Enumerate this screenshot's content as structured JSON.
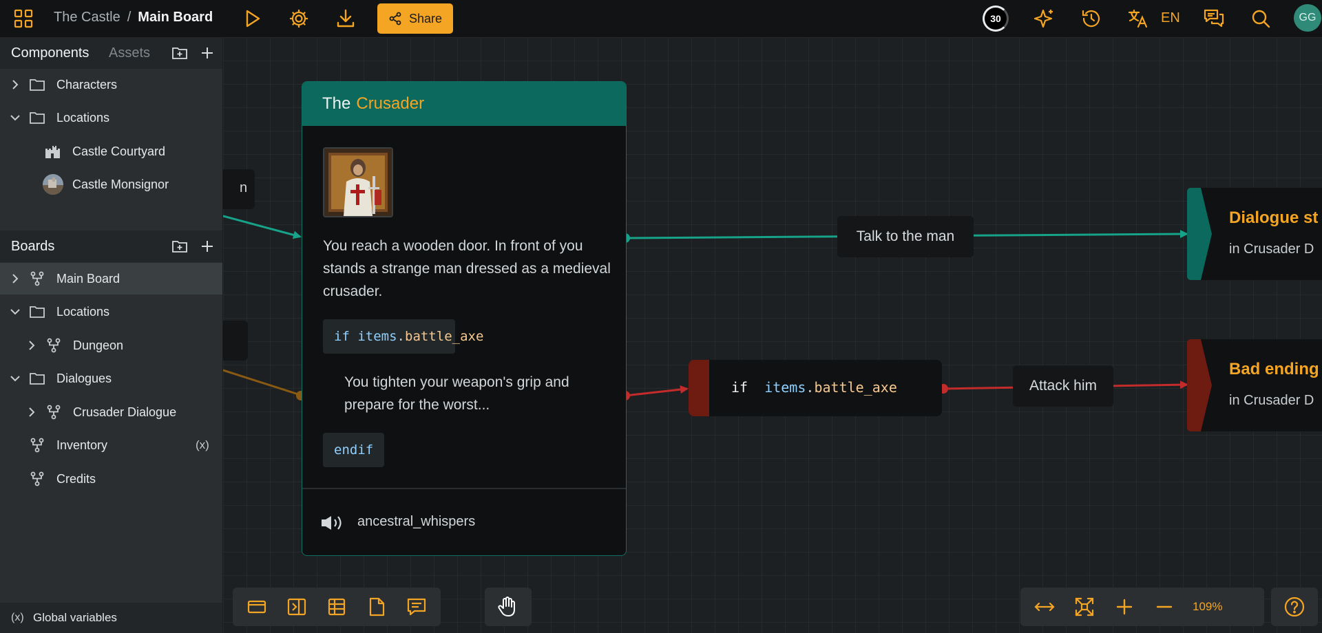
{
  "colors": {
    "accent": "#f5a524",
    "teal": "#0b6a5d",
    "danger": "#c42b2b",
    "danger_dark": "#6e1b12"
  },
  "topbar": {
    "project": "The Castle",
    "separator": "/",
    "board": "Main Board",
    "share_label": "Share",
    "counter": "30",
    "language": "EN",
    "avatar_initials": "GG",
    "icons": [
      "apps-grid-icon",
      "play-icon",
      "settings-icon",
      "download-icon",
      "share-icon",
      "sparkle-icon",
      "history-icon",
      "translate-icon",
      "comments-icon",
      "search-icon"
    ]
  },
  "sidebar": {
    "components_tab": "Components",
    "assets_tab": "Assets",
    "components": [
      {
        "label": "Characters",
        "icon": "folder-icon",
        "expanded": false
      },
      {
        "label": "Locations",
        "icon": "folder-icon",
        "expanded": true
      },
      {
        "label": "Castle Courtyard",
        "icon": "castle-icon"
      },
      {
        "label": "Castle Monsignor",
        "icon": "location-thumbnail"
      }
    ],
    "boards_title": "Boards",
    "boards": [
      {
        "label": "Main Board",
        "icon": "board-icon",
        "selected": true
      },
      {
        "label": "Locations",
        "icon": "folder-icon",
        "expanded": true
      },
      {
        "label": "Dungeon",
        "icon": "board-icon"
      },
      {
        "label": "Dialogues",
        "icon": "folder-icon",
        "expanded": true
      },
      {
        "label": "Crusader Dialogue",
        "icon": "board-icon"
      },
      {
        "label": "Inventory",
        "icon": "board-icon",
        "badge": "(x)"
      },
      {
        "label": "Credits",
        "icon": "board-icon"
      }
    ],
    "global_variables_icon": "(x)",
    "global_variables": "Global variables"
  },
  "canvas": {
    "left_stub_text": "n",
    "card": {
      "title_prefix": "The",
      "title_name": "Crusader",
      "portrait": "crusader-portrait",
      "text": "You reach a wooden door. In front of you stands a strange man dressed as a medieval crusader.",
      "if_keyword": "if",
      "if_object": "items",
      "if_dot": ".",
      "if_prop": "battle_axe",
      "branch_text": "You tighten your weapon's grip and prepare for the worst...",
      "endif_keyword": "endif",
      "audio": "ancestral_whispers"
    },
    "edges": [
      {
        "label": "Talk to the man"
      },
      {
        "label": "Attack him"
      }
    ],
    "condition_node": {
      "keyword": "if",
      "object": "items",
      "dot": ".",
      "prop": "battle_axe"
    },
    "targets": [
      {
        "title": "Dialogue st",
        "subtitle": "in Crusader D"
      },
      {
        "title": "Bad ending",
        "subtitle": "in Crusader D"
      }
    ]
  },
  "bottom_toolbar": {
    "tools": [
      "card-node-icon",
      "jump-node-icon",
      "table-node-icon",
      "note-node-icon",
      "comment-node-icon"
    ],
    "pan_tool": "hand-icon"
  },
  "zoom_toolbar": {
    "tools": [
      "fit-width-icon",
      "fullscreen-icon",
      "zoom-in-icon",
      "zoom-out-icon"
    ],
    "zoom": "109%",
    "help": "help-icon"
  }
}
